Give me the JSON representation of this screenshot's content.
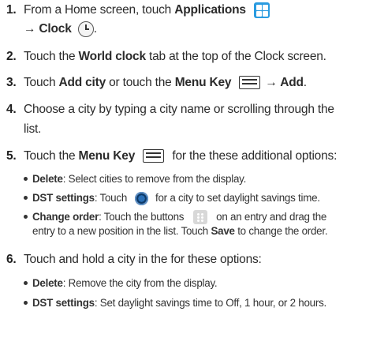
{
  "steps": [
    {
      "num": "1.",
      "parts": [
        "From a Home screen, touch ",
        "Applications",
        "→ Clock",
        "."
      ]
    },
    {
      "num": "2.",
      "parts": [
        "Touch the ",
        "World clock",
        " tab at the top of the Clock screen."
      ]
    },
    {
      "num": "3.",
      "parts": [
        "Touch ",
        "Add city",
        " or touch the ",
        "Menu Key",
        "→ Add",
        "."
      ]
    },
    {
      "num": "4.",
      "line1": "Choose a city by typing a city name or scrolling through the",
      "line2": "list."
    },
    {
      "num": "5.",
      "parts": [
        "Touch the ",
        "Menu Key",
        " for the these additional options:"
      ],
      "bullets": [
        {
          "term": "Delete",
          "text": ": Select cities to remove from the display."
        },
        {
          "term": "DST settings",
          "text": ": Touch ",
          "text2": " for a city to set daylight savings time."
        },
        {
          "term": "Change order",
          "text": ": Touch the buttons ",
          "text2": " on an entry and drag the",
          "line2a": "entry to a new position in the list. Touch ",
          "line2b": "Save",
          "line2c": " to change the order."
        }
      ]
    },
    {
      "num": "6.",
      "text": "Touch and hold a city in the for these options:",
      "bullets": [
        {
          "term": "Delete",
          "text": ": Remove the city from the display."
        },
        {
          "term": "DST settings",
          "text": ": Set daylight savings time to Off, 1 hour, or 2 hours."
        }
      ]
    }
  ],
  "icons": [
    "applications-icon",
    "clock-icon",
    "menu-key-icon",
    "dst-gear-icon",
    "reorder-grip-icon"
  ],
  "colors": {
    "apps_blue": "#2a9be0",
    "gear_blue": "#0d3a69"
  }
}
